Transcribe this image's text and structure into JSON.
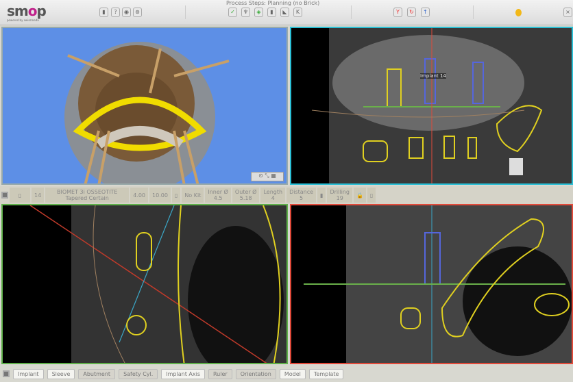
{
  "header": {
    "logo": "smop",
    "logo_sub": "powered by swissmeda",
    "process_steps": "Process Steps: Planning (no Brick)"
  },
  "panel_labels": {
    "implant_label": "Implant 14"
  },
  "info_bar": {
    "position": "14",
    "implant_name": "BIOMET 3i OSSEOTITE Tapered Certain",
    "diameter": "4.00",
    "length_val": "10.00",
    "kit": "No Kit",
    "inner_label": "Inner Ø",
    "inner": "4.5",
    "outer_label": "Outer Ø",
    "outer": "5.18",
    "length_label": "Length",
    "length": "4",
    "distance_label": "Distance",
    "distance": "5",
    "drilling_label": "Drilling",
    "drilling": "19"
  },
  "bottom_buttons": [
    {
      "label": "Implant",
      "on": true
    },
    {
      "label": "Sleeve",
      "on": true
    },
    {
      "label": "Abutment",
      "on": false
    },
    {
      "label": "Safety Cyl.",
      "on": false
    },
    {
      "label": "Implant Axis",
      "on": true
    },
    {
      "label": "Ruler",
      "on": false
    },
    {
      "label": "Orientation",
      "on": false
    },
    {
      "label": "Model",
      "on": true
    },
    {
      "label": "Template",
      "on": true
    }
  ],
  "colors": {
    "view3d": "#5d8fe6",
    "axial": "#2bc0d6",
    "cross": "#5fb04a",
    "sagittal": "#e24a3a",
    "contour": "#e0d020"
  }
}
